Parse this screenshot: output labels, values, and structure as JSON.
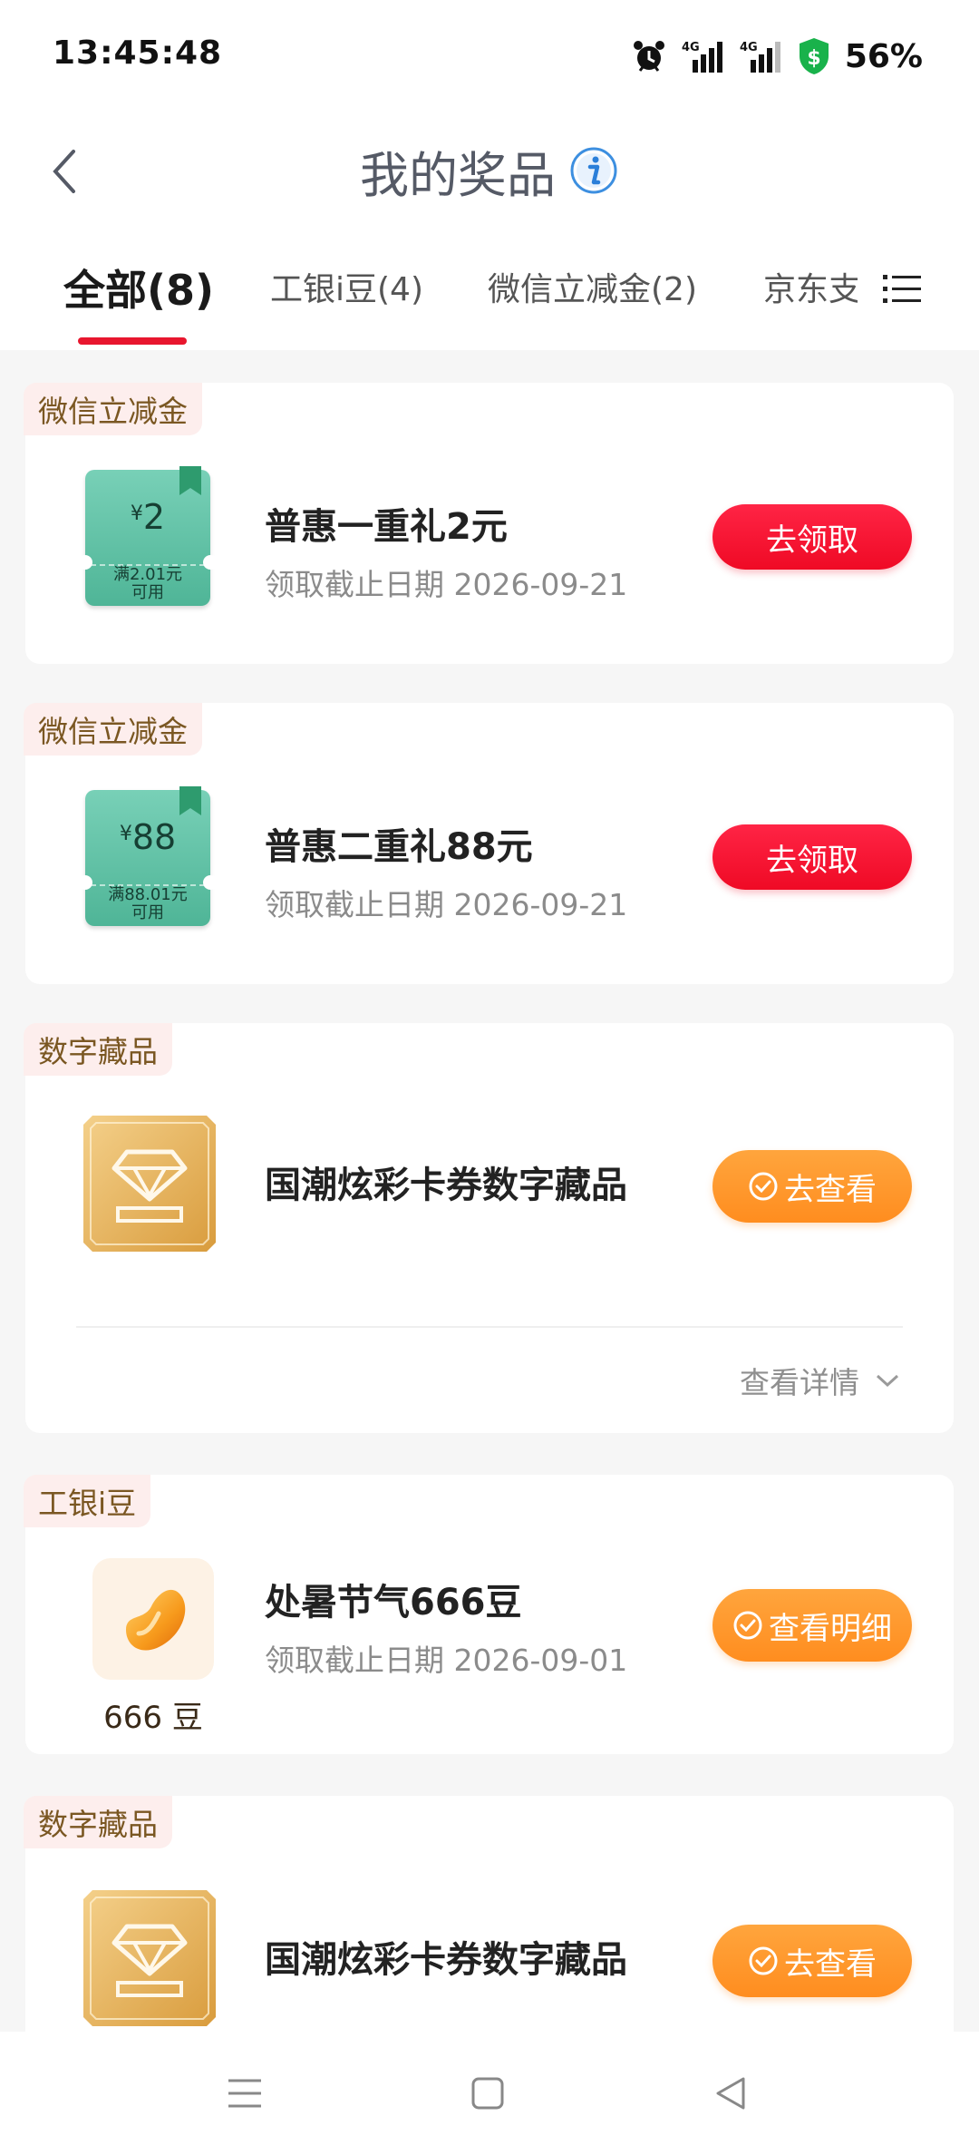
{
  "status_bar": {
    "time": "13:45:48",
    "battery": "56%",
    "icons": [
      "alarm-icon",
      "signal-4g-icon",
      "signal-4g-icon",
      "security-shield-icon"
    ]
  },
  "header": {
    "title": "我的奖品"
  },
  "tabs": [
    {
      "label": "全部(8)",
      "active": true
    },
    {
      "label": "工银i豆(4)",
      "active": false
    },
    {
      "label": "微信立减金(2)",
      "active": false
    },
    {
      "label": "京东支",
      "active": false
    }
  ],
  "cards": [
    {
      "tag": "微信立减金",
      "title": "普惠一重礼2元",
      "subtitle": "领取截止日期 2026-09-21",
      "button": "去领取",
      "coupon": {
        "symbol": "¥",
        "amount": "2",
        "condition_line1": "满2.01元",
        "condition_line2": "可用"
      }
    },
    {
      "tag": "微信立减金",
      "title": "普惠二重礼88元",
      "subtitle": "领取截止日期 2026-09-21",
      "button": "去领取",
      "coupon": {
        "symbol": "¥",
        "amount": "88",
        "condition_line1": "满88.01元",
        "condition_line2": "可用"
      }
    },
    {
      "tag": "数字藏品",
      "title": "国潮炫彩卡券数字藏品",
      "button": "去查看",
      "detail_link": "查看详情"
    },
    {
      "tag": "工银i豆",
      "title": "处暑节气666豆",
      "subtitle": "领取截止日期 2026-09-01",
      "button": "查看明细",
      "caption": "666 豆"
    },
    {
      "tag": "数字藏品",
      "title": "国潮炫彩卡券数字藏品",
      "button": "去查看"
    }
  ],
  "colors": {
    "accent_red": "#ee1a33",
    "accent_orange": "#ff9a2e",
    "tag_bg": "#fdeeed",
    "coupon_green": "#5fbfa3",
    "gold": "#e8b35a"
  }
}
